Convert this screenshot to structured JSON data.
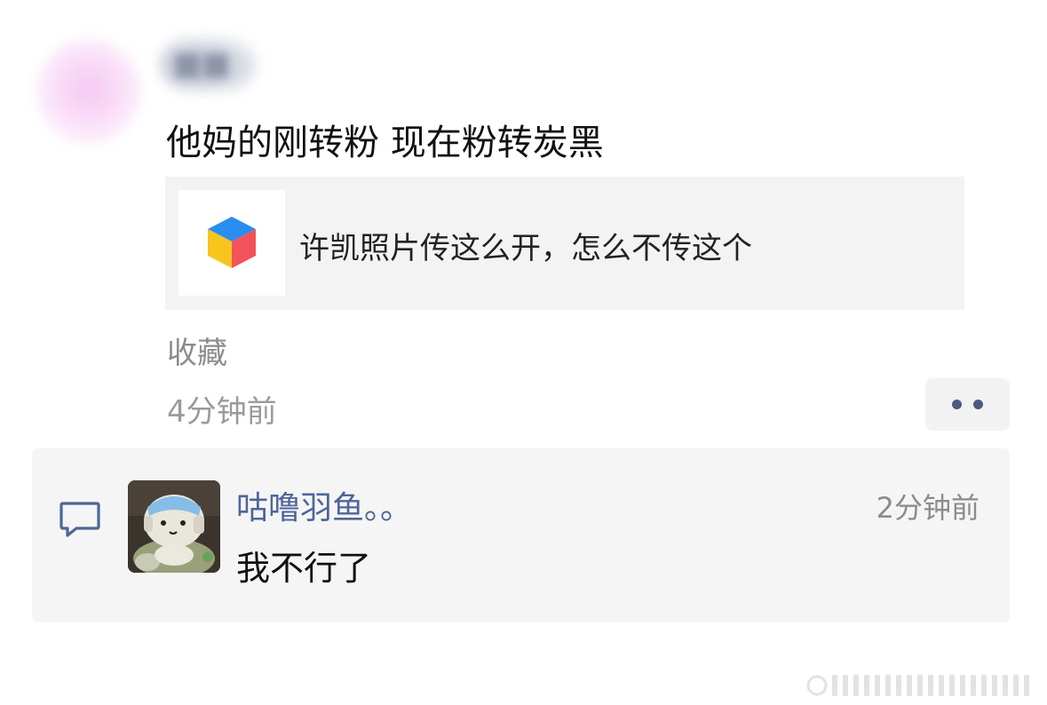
{
  "post": {
    "author_name": "■■",
    "text": "他妈的刚转粉 现在粉转炭黑",
    "link_card": {
      "icon": "cube-icon",
      "title": "许凯照片传这么开，怎么不传这个"
    },
    "collect_label": "收藏",
    "time": "4分钟前",
    "more_icon": "more-dots-icon"
  },
  "comments": [
    {
      "name": "咕噜羽鱼。。",
      "time": "2分钟前",
      "text": "我不行了"
    }
  ],
  "colors": {
    "link_blue": "#4d6699",
    "panel_bg": "#f5f5f5",
    "card_bg": "#f3f3f3"
  }
}
